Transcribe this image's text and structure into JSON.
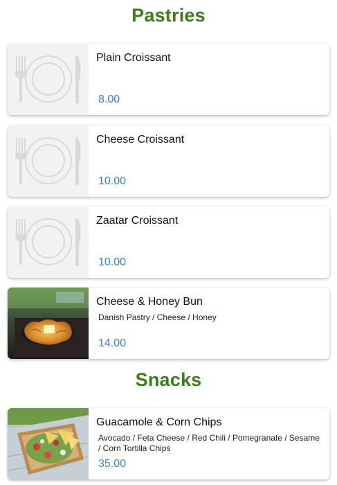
{
  "sections": [
    {
      "title": "Pastries",
      "items": [
        {
          "name": "Plain Croissant",
          "description": "",
          "price": "8.00",
          "image": "placeholder-plate-icon"
        },
        {
          "name": "Cheese Croissant",
          "description": "",
          "price": "10.00",
          "image": "placeholder-plate-icon"
        },
        {
          "name": "Zaatar Croissant",
          "description": "",
          "price": "10.00",
          "image": "placeholder-plate-icon"
        },
        {
          "name": "Cheese & Honey Bun",
          "description": "Danish Pastry / Cheese / Honey",
          "price": "14.00",
          "image": "cheese-honey-bun-photo"
        }
      ]
    },
    {
      "title": "Snacks",
      "items": [
        {
          "name": "Guacamole & Corn Chips",
          "description": "Avocado / Feta Cheese / Red Chili / Pomegranate / Sesame / Corn Tortilla Chips",
          "price": "35.00",
          "image": "guacamole-photo"
        }
      ]
    }
  ],
  "colors": {
    "section_title": "#3a7d1a",
    "price": "#3a7fc4",
    "card_bg": "#ffffff",
    "placeholder_bg": "#f2f2f2"
  }
}
